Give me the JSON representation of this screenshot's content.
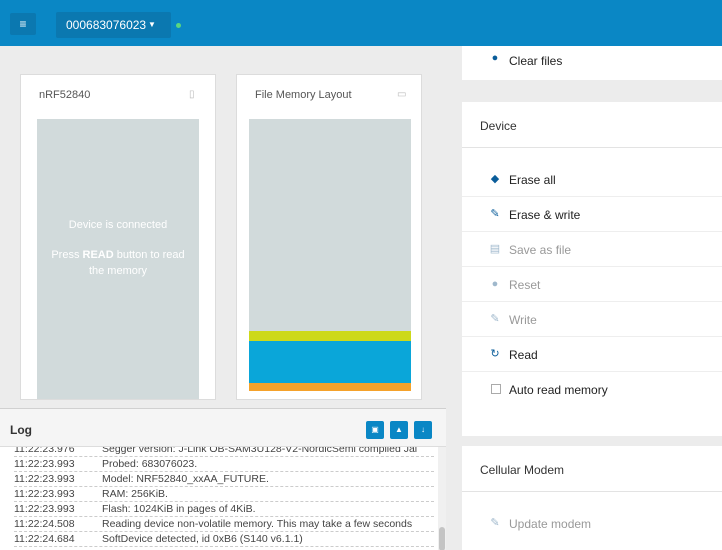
{
  "topbar": {
    "menu_icon": "hamburger-icon",
    "device_serial": "000683076023",
    "dropdown_icon": "caret-down-icon",
    "status_color": "#5bd67f",
    "accent_color": "#0a87c5"
  },
  "device_card": {
    "title": "nRF52840",
    "icon": "chip-icon",
    "message_line1": "Device is connected",
    "message_line2_pre": "Press ",
    "message_line2_bold": "READ",
    "message_line2_post": " button to read",
    "message_line3": "the memory"
  },
  "file_card": {
    "title": "File Memory Layout",
    "icon": "folder-icon",
    "regions_colors": [
      "#cdd91a",
      "#0aa6d9",
      "#f5a22b"
    ]
  },
  "log": {
    "title": "Log",
    "buttons": [
      "open-log-file-icon",
      "clear-log-icon",
      "scroll-down-icon"
    ],
    "lines": [
      {
        "time": "11:22:23.976",
        "text": "Segger version: J-Link OB-SAM3U128-V2-NordicSemi compiled Jai"
      },
      {
        "time": "11:22:23.993",
        "text": "Probed: 683076023."
      },
      {
        "time": "11:22:23.993",
        "text": "Model: NRF52840_xxAA_FUTURE."
      },
      {
        "time": "11:22:23.993",
        "text": "RAM: 256KiB."
      },
      {
        "time": "11:22:23.993",
        "text": "Flash: 1024KiB in pages of 4KiB."
      },
      {
        "time": "11:22:24.508",
        "text": "Reading device non-volatile memory. This may take a few seconds"
      },
      {
        "time": "11:22:24.684",
        "text": "SoftDevice detected, id 0xB6 (S140 v6.1.1)"
      }
    ]
  },
  "files_panel": {
    "clear_files_label": "Clear files",
    "clear_files_icon": "minus-circle-icon"
  },
  "device_panel": {
    "title": "Device",
    "actions": [
      {
        "label": "Erase all",
        "icon": "eraser-icon",
        "enabled": true
      },
      {
        "label": "Erase & write",
        "icon": "pencil-icon",
        "enabled": true
      },
      {
        "label": "Save as file",
        "icon": "save-icon",
        "enabled": false
      },
      {
        "label": "Reset",
        "icon": "dot-icon",
        "enabled": false
      },
      {
        "label": "Write",
        "icon": "pencil-icon",
        "enabled": false
      },
      {
        "label": "Read",
        "icon": "refresh-icon",
        "enabled": true
      }
    ],
    "auto_read_label": "Auto read memory"
  },
  "cellular_panel": {
    "title": "Cellular Modem",
    "update_label": "Update modem",
    "update_icon": "pencil-icon"
  }
}
